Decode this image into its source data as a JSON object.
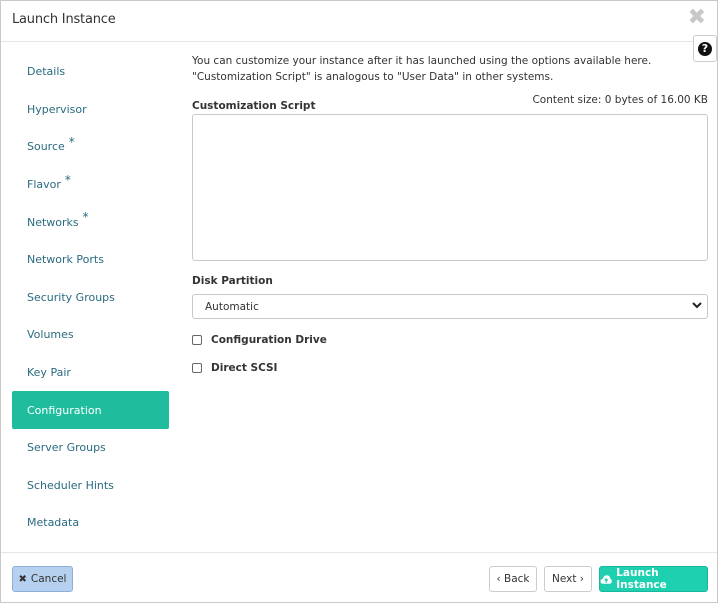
{
  "dialog": {
    "title": "Launch Instance",
    "close_glyph": "✖",
    "help_glyph": "?"
  },
  "nav": {
    "items": [
      {
        "label": "Details",
        "required": false
      },
      {
        "label": "Hypervisor",
        "required": false
      },
      {
        "label": "Source",
        "required": true
      },
      {
        "label": "Flavor",
        "required": true
      },
      {
        "label": "Networks",
        "required": true
      },
      {
        "label": "Network Ports",
        "required": false
      },
      {
        "label": "Security Groups",
        "required": false
      },
      {
        "label": "Volumes",
        "required": false
      },
      {
        "label": "Key Pair",
        "required": false
      },
      {
        "label": "Configuration",
        "required": false,
        "active": true
      },
      {
        "label": "Server Groups",
        "required": false
      },
      {
        "label": "Scheduler Hints",
        "required": false
      },
      {
        "label": "Metadata",
        "required": false
      }
    ],
    "required_mark": "*"
  },
  "content": {
    "intro": "You can customize your instance after it has launched using the options available here. \"Customization Script\" is analogous to \"User Data\" in other systems.",
    "script_label": "Customization Script",
    "content_size": "Content size: 0 bytes of 16.00 KB",
    "script_value": "",
    "disk_label": "Disk Partition",
    "disk_selected": "Automatic",
    "config_drive_label": "Configuration Drive",
    "config_drive_checked": false,
    "direct_scsi_label": "Direct SCSI",
    "direct_scsi_checked": false
  },
  "footer": {
    "cancel": "Cancel",
    "back": "‹ Back",
    "next": "Next ›",
    "launch": "Launch Instance"
  },
  "colors": {
    "accent": "#1fbd9e",
    "launch": "#1fd0b0",
    "cancel_bg": "#b6d0ef",
    "link": "#2a6b80"
  },
  "icons": {
    "close": "close-icon",
    "help": "help-icon",
    "cancel": "times-icon",
    "launch": "cloud-upload-icon",
    "select": "chevron-down-icon"
  }
}
